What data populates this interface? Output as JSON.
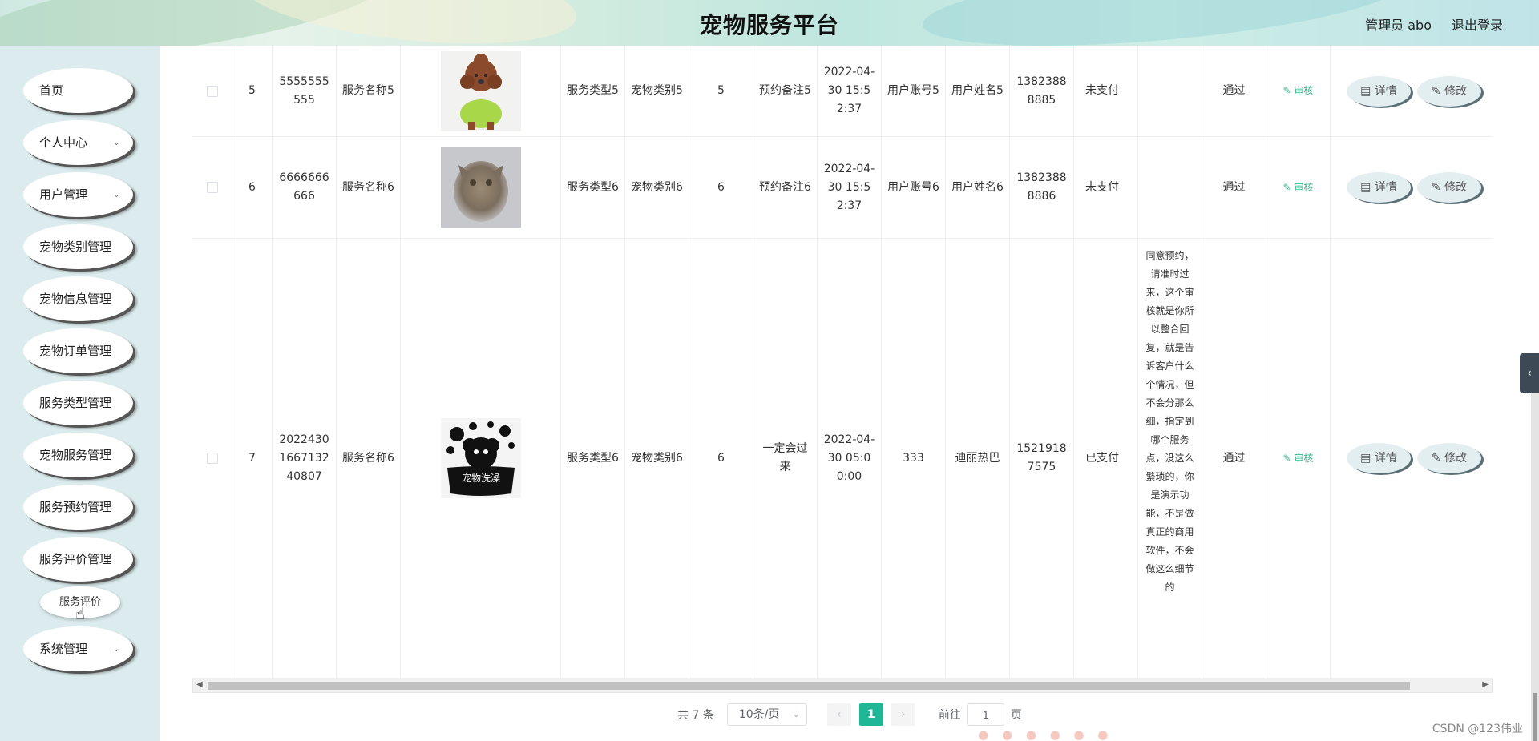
{
  "header": {
    "title": "宠物服务平台",
    "user": "管理员 abo",
    "logout": "退出登录"
  },
  "sidebar": {
    "items": [
      {
        "label": "首页"
      },
      {
        "label": "个人中心"
      },
      {
        "label": "用户管理"
      },
      {
        "label": "宠物类别管理"
      },
      {
        "label": "宠物信息管理"
      },
      {
        "label": "宠物订单管理"
      },
      {
        "label": "服务类型管理"
      },
      {
        "label": "宠物服务管理"
      },
      {
        "label": "服务预约管理"
      },
      {
        "label": "服务评价管理"
      },
      {
        "label": "系统管理"
      }
    ],
    "submenu": {
      "label": "服务评价"
    }
  },
  "table": {
    "rows": [
      {
        "index": "5",
        "order_no": "5555555555",
        "service_name": "服务名称5",
        "service_type": "服务类型5",
        "pet_category": "宠物类别5",
        "quantity": "5",
        "remark": "预约备注5",
        "date": "2022-04-30 15:52:37",
        "user_account": "用户账号5",
        "user_name": "用户姓名5",
        "phone": "13823888885",
        "pay_status": "未支付",
        "reply": "",
        "audit_status": "通过",
        "audit_link": "审核",
        "detail_btn": "详情",
        "edit_btn": "修改"
      },
      {
        "index": "6",
        "order_no": "6666666666",
        "service_name": "服务名称6",
        "service_type": "服务类型6",
        "pet_category": "宠物类别6",
        "quantity": "6",
        "remark": "预约备注6",
        "date": "2022-04-30 15:52:37",
        "user_account": "用户账号6",
        "user_name": "用户姓名6",
        "phone": "13823888886",
        "pay_status": "未支付",
        "reply": "",
        "audit_status": "通过",
        "audit_link": "审核",
        "detail_btn": "详情",
        "edit_btn": "修改"
      },
      {
        "index": "7",
        "order_no": "20224301667132 40807",
        "service_name": "服务名称6",
        "service_type": "服务类型6",
        "pet_category": "宠物类别6",
        "quantity": "6",
        "remark": "一定会过来",
        "date": "2022-04-30 05:00:00",
        "user_account": "333",
        "user_name": "迪丽热巴",
        "phone": "15219187575",
        "pay_status": "已支付",
        "reply": "同意预约，请准时过来，这个审核就是你所以整合回复，就是告诉客户什么个情况，但不会分那么细，指定到哪个服务点，没这么繁琐的，你是演示功能，不是做真正的商用软件，不会做这么细节的",
        "audit_status": "通过",
        "audit_link": "审核",
        "detail_btn": "详情",
        "edit_btn": "修改",
        "logo_text": "宠物洗澡"
      }
    ]
  },
  "pagination": {
    "total": "共 7 条",
    "page_size": "10条/页",
    "current": "1",
    "goto_label": "前往",
    "goto_value": "1",
    "page_suffix": "页"
  },
  "watermark": "CSDN @123伟业",
  "colors": {
    "accent": "#20b797",
    "audit": "#3cb48c",
    "sidebar_bg": "#dcecee"
  }
}
